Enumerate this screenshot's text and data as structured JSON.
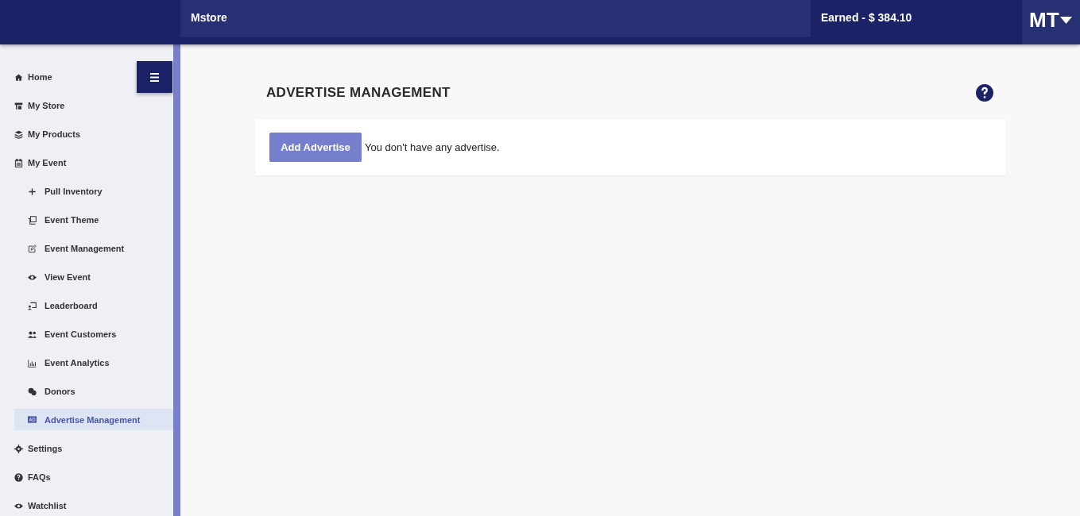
{
  "topbar": {
    "title": "Mstore",
    "earned": "Earned - $ 384.10",
    "user_initials": "MT"
  },
  "sidebar": {
    "items": [
      {
        "label": "Home",
        "selected": false
      },
      {
        "label": "My Store",
        "selected": false
      },
      {
        "label": "My Products",
        "selected": false
      },
      {
        "label": "My Event",
        "selected": false,
        "children": [
          {
            "label": "Pull Inventory",
            "selected": false
          },
          {
            "label": "Event Theme",
            "selected": false
          },
          {
            "label": "Event Management",
            "selected": false
          },
          {
            "label": "View Event",
            "selected": false
          },
          {
            "label": "Leaderboard",
            "selected": false
          },
          {
            "label": "Event Customers",
            "selected": false
          },
          {
            "label": "Event Analytics",
            "selected": false
          },
          {
            "label": "Donors",
            "selected": false
          },
          {
            "label": "Advertise Management",
            "selected": true
          }
        ]
      },
      {
        "label": "Settings",
        "selected": false
      },
      {
        "label": "FAQs",
        "selected": false
      },
      {
        "label": "Watchlist",
        "selected": false
      }
    ]
  },
  "page": {
    "heading": "ADVERTISE MANAGEMENT",
    "add_button": "Add Advertise",
    "empty_message": "You don't have any advertise."
  }
}
